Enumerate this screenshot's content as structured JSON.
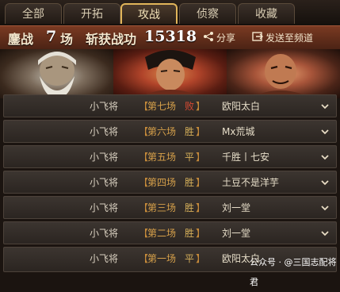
{
  "tabs": [
    {
      "label": "全部",
      "active": false
    },
    {
      "label": "开拓",
      "active": false
    },
    {
      "label": "攻战",
      "active": true
    },
    {
      "label": "侦察",
      "active": false
    },
    {
      "label": "收藏",
      "active": false
    }
  ],
  "summary": {
    "battle_label": "鏖战",
    "battle_count": "7",
    "battle_unit": "场",
    "merit_label": "斩获战功",
    "merit_value": "15318",
    "share_label": "分享",
    "send_label": "发送至频道"
  },
  "portraits": [
    {
      "icon": "old-general-portrait"
    },
    {
      "icon": "young-general-portrait"
    },
    {
      "icon": "bald-general-portrait"
    }
  ],
  "rows": [
    {
      "player": "小飞将",
      "battle": "第七场",
      "result": "败",
      "result_type": "lose",
      "opponent": "欧阳太白"
    },
    {
      "player": "小飞将",
      "battle": "第六场",
      "result": "胜",
      "result_type": "win",
      "opponent": "Mx荒城"
    },
    {
      "player": "小飞将",
      "battle": "第五场",
      "result": "平",
      "result_type": "draw",
      "opponent": "千胜丨七安"
    },
    {
      "player": "小飞将",
      "battle": "第四场",
      "result": "胜",
      "result_type": "win",
      "opponent": "土豆不是洋芋"
    },
    {
      "player": "小飞将",
      "battle": "第三场",
      "result": "胜",
      "result_type": "win",
      "opponent": "刘一堂"
    },
    {
      "player": "小飞将",
      "battle": "第二场",
      "result": "胜",
      "result_type": "win",
      "opponent": "刘一堂"
    },
    {
      "player": "小飞将",
      "battle": "第一场",
      "result": "平",
      "result_type": "draw",
      "opponent": "欧阳太白"
    }
  ],
  "brackets": {
    "left": "【",
    "right": "】"
  },
  "watermark": "公众号 · @三国志配将君",
  "colors": {
    "accent": "#e1b55a",
    "win": "#d6b05a",
    "lose": "#d84a32",
    "summary_bg": "#6a321d"
  }
}
